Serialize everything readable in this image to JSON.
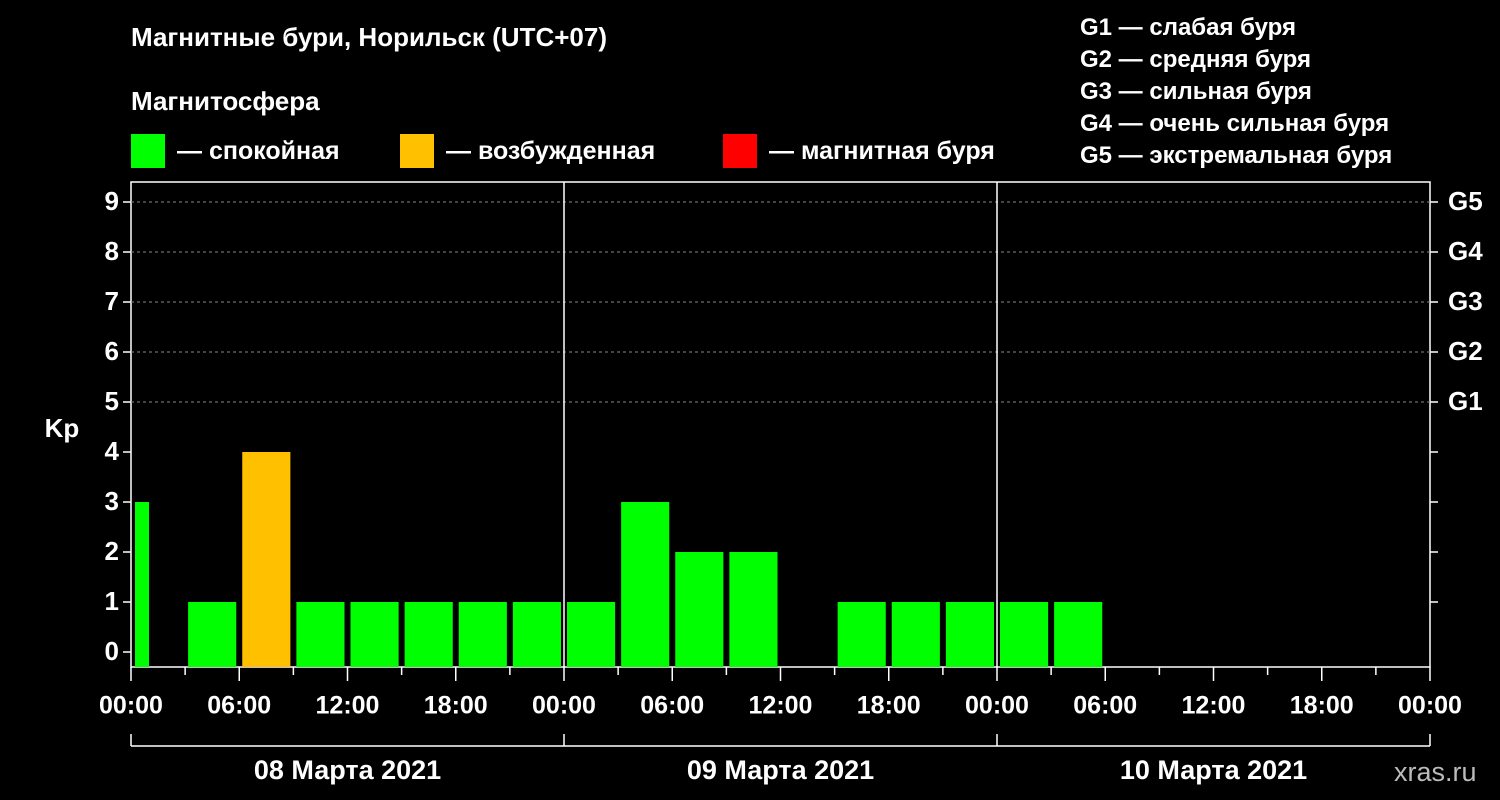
{
  "header": {
    "title": "Магнитные бури, Норильск (UTC+07)",
    "subtitle": "Магнитосфера"
  },
  "legend": [
    {
      "label": "— спокойная",
      "color": "#00ff00"
    },
    {
      "label": "— возбужденная",
      "color": "#ffc000"
    },
    {
      "label": "— магнитная буря",
      "color": "#ff0000"
    }
  ],
  "g_legend": [
    "G1 — слабая буря",
    "G2 — средняя буря",
    "G3 — сильная буря",
    "G4 — очень сильная буря",
    "G5 — экстремальная буря"
  ],
  "watermark": "xras.ru",
  "chart_data": {
    "type": "bar",
    "ylabel": "Kp",
    "ylim": [
      0,
      9
    ],
    "yticks": [
      "0",
      "1",
      "2",
      "3",
      "4",
      "5",
      "6",
      "7",
      "8",
      "9"
    ],
    "right_ticks": [
      {
        "kp": 5,
        "label": "G1"
      },
      {
        "kp": 6,
        "label": "G2"
      },
      {
        "kp": 7,
        "label": "G3"
      },
      {
        "kp": 8,
        "label": "G4"
      },
      {
        "kp": 9,
        "label": "G5"
      }
    ],
    "x_tick_labels": [
      "00:00",
      "06:00",
      "12:00",
      "18:00",
      "00:00",
      "06:00",
      "12:00",
      "18:00",
      "00:00",
      "06:00",
      "12:00",
      "18:00",
      "00:00"
    ],
    "days": [
      "08 Марта 2021",
      "09 Марта 2021",
      "10 Марта 2021"
    ],
    "grid": true,
    "series": [
      {
        "values": [
          3,
          1,
          4,
          1,
          1,
          1,
          1,
          1,
          1,
          3,
          2,
          2,
          null,
          1,
          1,
          1,
          1,
          1,
          null,
          null,
          null,
          null,
          null,
          null
        ],
        "colors": [
          "#00ff00",
          "#00ff00",
          "#ffc000",
          "#00ff00",
          "#00ff00",
          "#00ff00",
          "#00ff00",
          "#00ff00",
          "#00ff00",
          "#00ff00",
          "#00ff00",
          "#00ff00",
          null,
          "#00ff00",
          "#00ff00",
          "#00ff00",
          "#00ff00",
          "#00ff00",
          null,
          null,
          null,
          null,
          null,
          null
        ]
      }
    ]
  }
}
